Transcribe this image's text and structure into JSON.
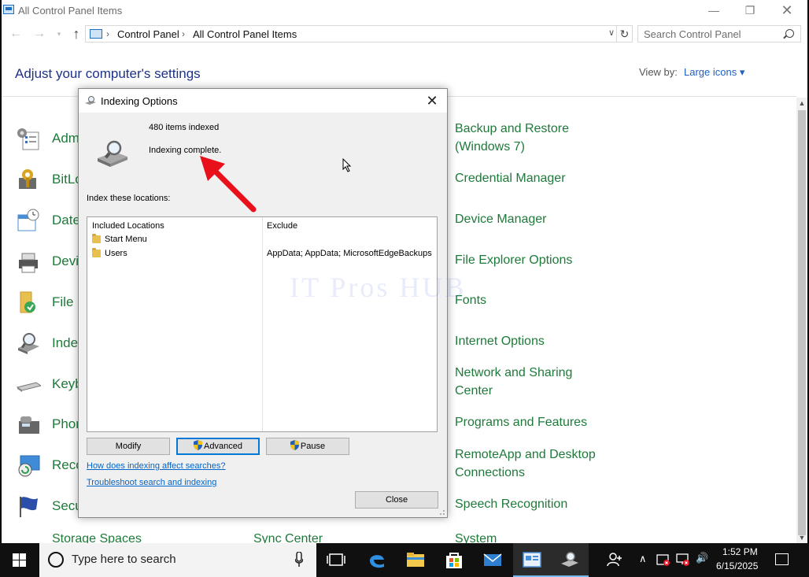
{
  "window": {
    "title": "All Control Panel Items",
    "minimize_glyph": "—",
    "maximize_glyph": "❐",
    "close_glyph": "✕"
  },
  "address": {
    "back_glyph": "←",
    "forward_glyph": "→",
    "recent_glyph": "▾",
    "up_glyph": "↑",
    "crumbs": [
      "Control Panel",
      "All Control Panel Items"
    ],
    "separator": "›",
    "dropdown_glyph": "∨",
    "refresh_glyph": "↻",
    "search_placeholder": "Search Control Panel"
  },
  "content": {
    "heading": "Adjust your computer's settings",
    "view_by_label": "View by:",
    "view_by_value": "Large icons ▾",
    "left_items": [
      {
        "label": "Adm",
        "icon": "administrative-tools-icon"
      },
      {
        "label": "BitLo",
        "icon": "bitlocker-icon"
      },
      {
        "label": "Date",
        "icon": "date-time-icon"
      },
      {
        "label": "Devi",
        "icon": "devices-printers-icon"
      },
      {
        "label": "File H",
        "icon": "file-history-icon"
      },
      {
        "label": "Index",
        "icon": "indexing-options-icon"
      },
      {
        "label": "Keyb",
        "icon": "keyboard-icon"
      },
      {
        "label": "Phon",
        "icon": "phone-modem-icon"
      },
      {
        "label": "Reco",
        "icon": "recovery-icon"
      },
      {
        "label": "Secu",
        "icon": "security-maintenance-icon"
      }
    ],
    "right_items": [
      {
        "line1": "Backup and Restore",
        "line2": "(Windows 7)"
      },
      {
        "line1": "Credential Manager",
        "line2": ""
      },
      {
        "line1": "Device Manager",
        "line2": ""
      },
      {
        "line1": "File Explorer Options",
        "line2": ""
      },
      {
        "line1": "Fonts",
        "line2": ""
      },
      {
        "line1": "Internet Options",
        "line2": ""
      },
      {
        "line1": "Network and Sharing",
        "line2": "Center"
      },
      {
        "line1": "Programs and Features",
        "line2": ""
      },
      {
        "line1": "RemoteApp and Desktop",
        "line2": "Connections"
      },
      {
        "line1": "Speech Recognition",
        "line2": ""
      }
    ],
    "partial_bottom": [
      "Storage Spaces",
      "Sync Center",
      "System"
    ]
  },
  "dialog": {
    "title": "Indexing Options",
    "close_glyph": "✕",
    "items_indexed": "480 items indexed",
    "status": "Indexing complete.",
    "section_label": "Index these locations:",
    "col_included": "Included Locations",
    "col_exclude": "Exclude",
    "locations": [
      {
        "name": "Start Menu",
        "exclude": ""
      },
      {
        "name": "Users",
        "exclude": "AppData; AppData; MicrosoftEdgeBackups"
      }
    ],
    "btn_modify": "Modify",
    "btn_advanced": "Advanced",
    "btn_pause": "Pause",
    "link_affect": "How does indexing affect searches?",
    "link_troubleshoot": "Troubleshoot search and indexing",
    "btn_close": "Close"
  },
  "watermark": "IT Pros HUB",
  "taskbar": {
    "search_placeholder": "Type here to search",
    "time": "1:52 PM",
    "date": "6/15/2025",
    "tray_up_glyph": "∧",
    "volume_glyph": "🔊"
  },
  "colors": {
    "link_green": "#1e7a3a",
    "heading_blue": "#1e3287",
    "annotation_red": "#e8101a",
    "taskbar": "#101010"
  }
}
